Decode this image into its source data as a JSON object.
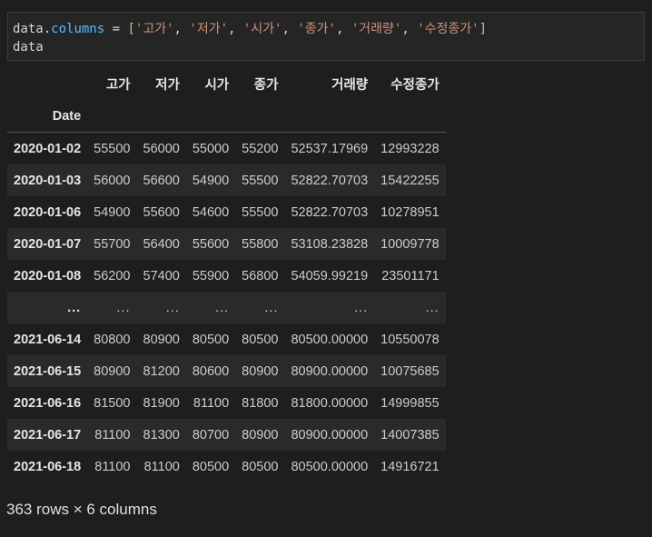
{
  "code": {
    "line1": {
      "var": "data",
      "dot": ".",
      "attr": "columns",
      "eq": " = ",
      "open": "[",
      "items": [
        "'고가'",
        "'저가'",
        "'시가'",
        "'종가'",
        "'거래량'",
        "'수정종가'"
      ],
      "sep": ", ",
      "close": "]"
    },
    "line2": "data"
  },
  "table": {
    "columns": [
      "고가",
      "저가",
      "시가",
      "종가",
      "거래량",
      "수정종가"
    ],
    "index_name": "Date",
    "rows": [
      {
        "date": "2020-01-02",
        "values": [
          "55500",
          "56000",
          "55000",
          "55200",
          "52537.17969",
          "12993228"
        ]
      },
      {
        "date": "2020-01-03",
        "values": [
          "56000",
          "56600",
          "54900",
          "55500",
          "52822.70703",
          "15422255"
        ]
      },
      {
        "date": "2020-01-06",
        "values": [
          "54900",
          "55600",
          "54600",
          "55500",
          "52822.70703",
          "10278951"
        ]
      },
      {
        "date": "2020-01-07",
        "values": [
          "55700",
          "56400",
          "55600",
          "55800",
          "53108.23828",
          "10009778"
        ]
      },
      {
        "date": "2020-01-08",
        "values": [
          "56200",
          "57400",
          "55900",
          "56800",
          "54059.99219",
          "23501171"
        ]
      },
      {
        "date": "...",
        "values": [
          "...",
          "...",
          "...",
          "...",
          "...",
          "..."
        ]
      },
      {
        "date": "2021-06-14",
        "values": [
          "80800",
          "80900",
          "80500",
          "80500",
          "80500.00000",
          "10550078"
        ]
      },
      {
        "date": "2021-06-15",
        "values": [
          "80900",
          "81200",
          "80600",
          "80900",
          "80900.00000",
          "10075685"
        ]
      },
      {
        "date": "2021-06-16",
        "values": [
          "81500",
          "81900",
          "81100",
          "81800",
          "81800.00000",
          "14999855"
        ]
      },
      {
        "date": "2021-06-17",
        "values": [
          "81100",
          "81300",
          "80700",
          "80900",
          "80900.00000",
          "14007385"
        ]
      },
      {
        "date": "2021-06-18",
        "values": [
          "81100",
          "81100",
          "80500",
          "80500",
          "80500.00000",
          "14916721"
        ]
      }
    ]
  },
  "shape_text": "363 rows × 6 columns"
}
